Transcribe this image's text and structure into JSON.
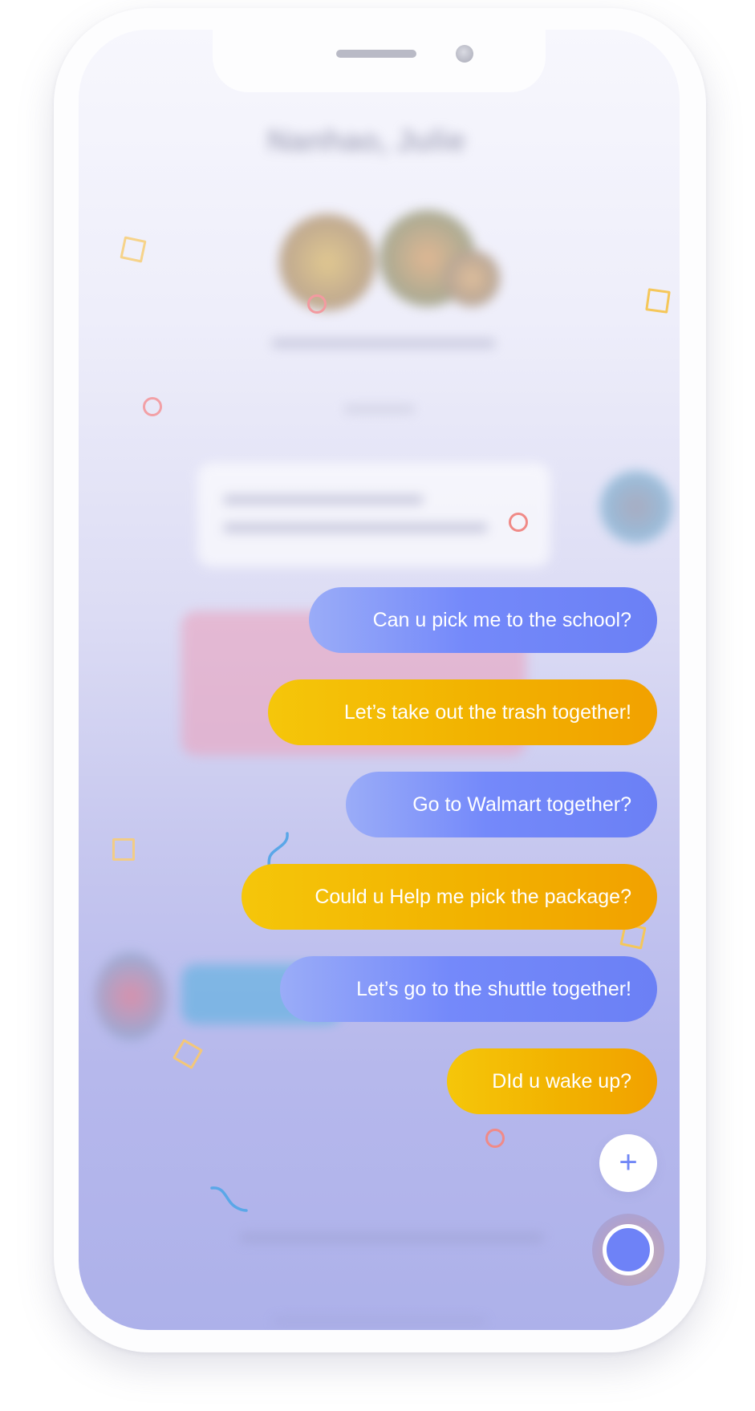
{
  "header": {
    "title": "Nanhao, Julie"
  },
  "suggestions": [
    {
      "label": "Can u pick me to the school?",
      "style": "blue"
    },
    {
      "label": "Let’s take out the trash together!",
      "style": "orange"
    },
    {
      "label": "Go to Walmart together?",
      "style": "blue"
    },
    {
      "label": "Could u Help me pick the package?",
      "style": "orange"
    },
    {
      "label": "Let’s go to the shuttle together!",
      "style": "blue"
    },
    {
      "label": "DId u wake up?",
      "style": "orange"
    }
  ],
  "actions": {
    "add_icon": "plus-icon",
    "record_icon": "record-icon"
  },
  "colors": {
    "blue_bubble": "#7489fa",
    "orange_bubble": "#f2b200",
    "accent": "#6e82f7",
    "decor_yellow": "#f5cf6a",
    "decor_coral": "#f08a87",
    "decor_blue": "#5aa7e8"
  }
}
